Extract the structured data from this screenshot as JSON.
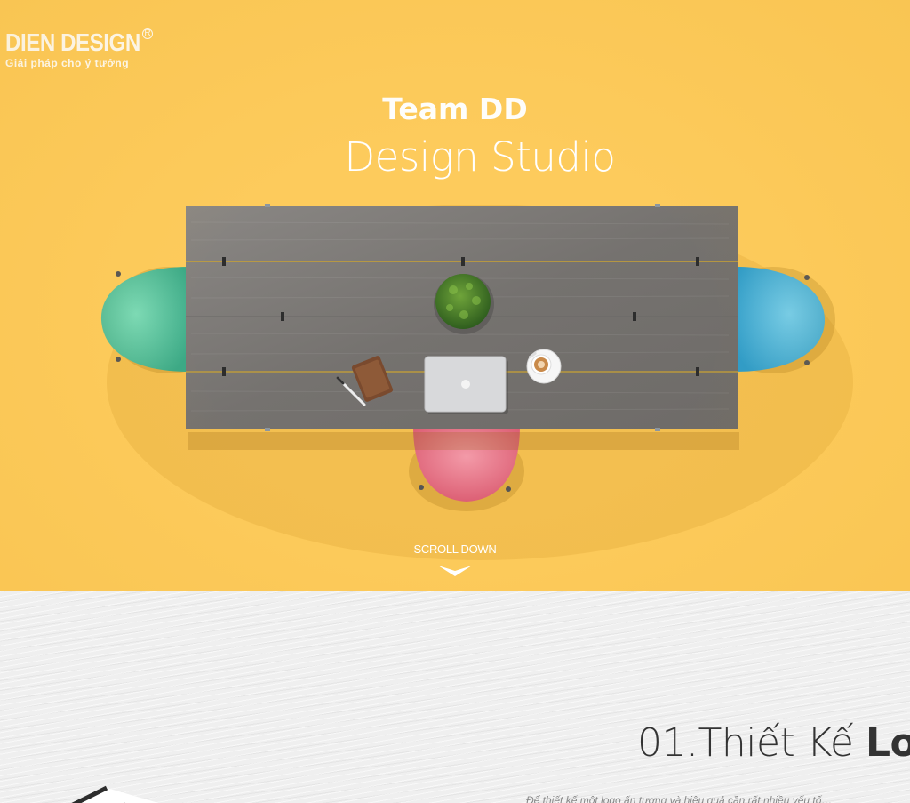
{
  "brand": {
    "name": "DIEN DESIGN",
    "registered": "R",
    "tagline": "Giải pháp cho ý tưởng"
  },
  "hero": {
    "title": "Team DD",
    "subtitle": "Design Studio",
    "scroll_label": "SCROLL DOWN",
    "background_color": "#FDCB5C"
  },
  "section1": {
    "heading_light": "01.Thiết Kế ",
    "heading_bold": "Lo",
    "intro_text": "Để thiết kế một logo ấn tượng và hiệu quả cần rất nhiều yếu tố…"
  },
  "icons": {
    "scroll": "chevron-down-icon",
    "plant": "plant-icon",
    "laptop": "laptop-icon",
    "coffee": "coffee-cup-icon",
    "notebook": "notebook-icon",
    "pen": "pen-icon"
  },
  "colors": {
    "chair_green": "#4DBF9B",
    "chair_blue": "#3FB1DB",
    "chair_pink": "#E56478",
    "table": "#7C7A78"
  }
}
